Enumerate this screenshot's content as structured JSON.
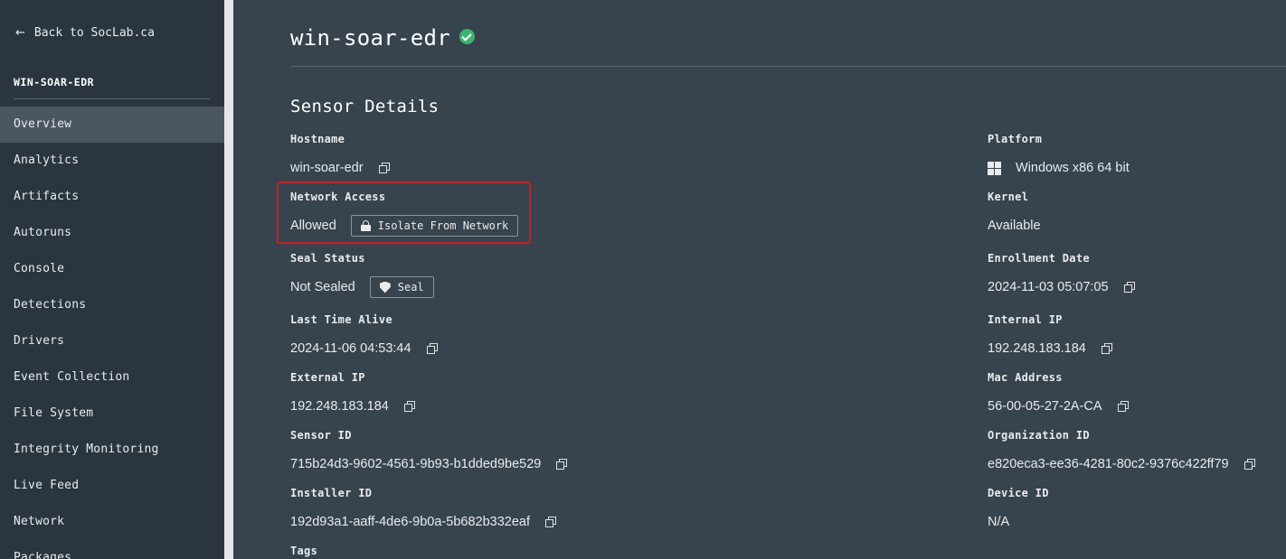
{
  "sidebar": {
    "back_label": "Back to SocLab.ca",
    "sensor_name": "WIN-SOAR-EDR",
    "items": [
      {
        "label": "Overview"
      },
      {
        "label": "Analytics"
      },
      {
        "label": "Artifacts"
      },
      {
        "label": "Autoruns"
      },
      {
        "label": "Console"
      },
      {
        "label": "Detections"
      },
      {
        "label": "Drivers"
      },
      {
        "label": "Event Collection"
      },
      {
        "label": "File System"
      },
      {
        "label": "Integrity Monitoring"
      },
      {
        "label": "Live Feed"
      },
      {
        "label": "Network"
      },
      {
        "label": "Packages"
      }
    ],
    "active_item": "Overview"
  },
  "header": {
    "title": "win-soar-edr",
    "status_icon": "check-circle-icon",
    "status_color": "#3cb371"
  },
  "section_title": "Sensor Details",
  "fields": {
    "hostname": {
      "label": "Hostname",
      "value": "win-soar-edr"
    },
    "network_access": {
      "label": "Network Access",
      "value": "Allowed",
      "button": "Isolate From Network"
    },
    "seal_status": {
      "label": "Seal Status",
      "value": "Not Sealed",
      "button": "Seal"
    },
    "last_alive": {
      "label": "Last Time Alive",
      "value": "2024-11-06 04:53:44"
    },
    "external_ip": {
      "label": "External IP",
      "value": "192.248.183.184"
    },
    "sensor_id": {
      "label": "Sensor ID",
      "value": "715b24d3-9602-4561-9b93-b1dded9be529"
    },
    "installer_id": {
      "label": "Installer ID",
      "value": "192d93a1-aaff-4de6-9b0a-5b682b332eaf"
    },
    "tags": {
      "label": "Tags"
    },
    "platform": {
      "label": "Platform",
      "value": "Windows x86 64 bit"
    },
    "kernel": {
      "label": "Kernel",
      "value": "Available"
    },
    "enrollment_date": {
      "label": "Enrollment Date",
      "value": "2024-11-03 05:07:05"
    },
    "internal_ip": {
      "label": "Internal IP",
      "value": "192.248.183.184"
    },
    "mac_address": {
      "label": "Mac Address",
      "value": "56-00-05-27-2A-CA"
    },
    "organization_id": {
      "label": "Organization ID",
      "value": "e820eca3-ee36-4281-80c2-9376c422ff79"
    },
    "device_id": {
      "label": "Device ID",
      "value": "N/A"
    }
  },
  "colors": {
    "highlight": "#b3262c",
    "background": "#37434d",
    "sidebar": "#2b353f"
  }
}
